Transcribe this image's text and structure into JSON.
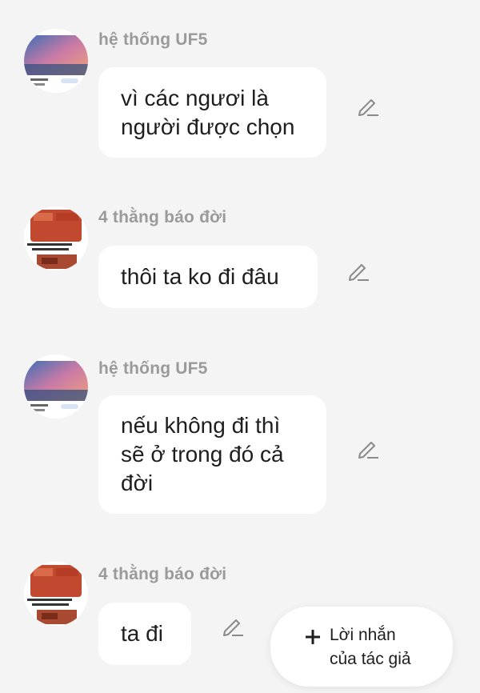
{
  "messages": [
    {
      "sender": "hệ thống UF5",
      "avatar": "avatar-uf5",
      "text": "vì các ngươi là\nngười được chọn"
    },
    {
      "sender": "4 thằng báo đời",
      "avatar": "avatar-brick",
      "text": "thôi ta ko đi đâu"
    },
    {
      "sender": "hệ thống UF5",
      "avatar": "avatar-uf5",
      "text": "nếu không đi thì\nsẽ ở trong đó cả\nđời"
    },
    {
      "sender": "4 thằng báo đời",
      "avatar": "avatar-brick",
      "text": "ta đi"
    }
  ],
  "icons": {
    "edit": "pencil-icon",
    "add": "plus-icon"
  },
  "fab": {
    "line1": "Lời nhắn",
    "line2": "của tác giả"
  },
  "colors": {
    "background": "#f4f4f4",
    "bubble": "#ffffff",
    "sender": "#9a9a9a",
    "text": "#1e1e1e"
  }
}
